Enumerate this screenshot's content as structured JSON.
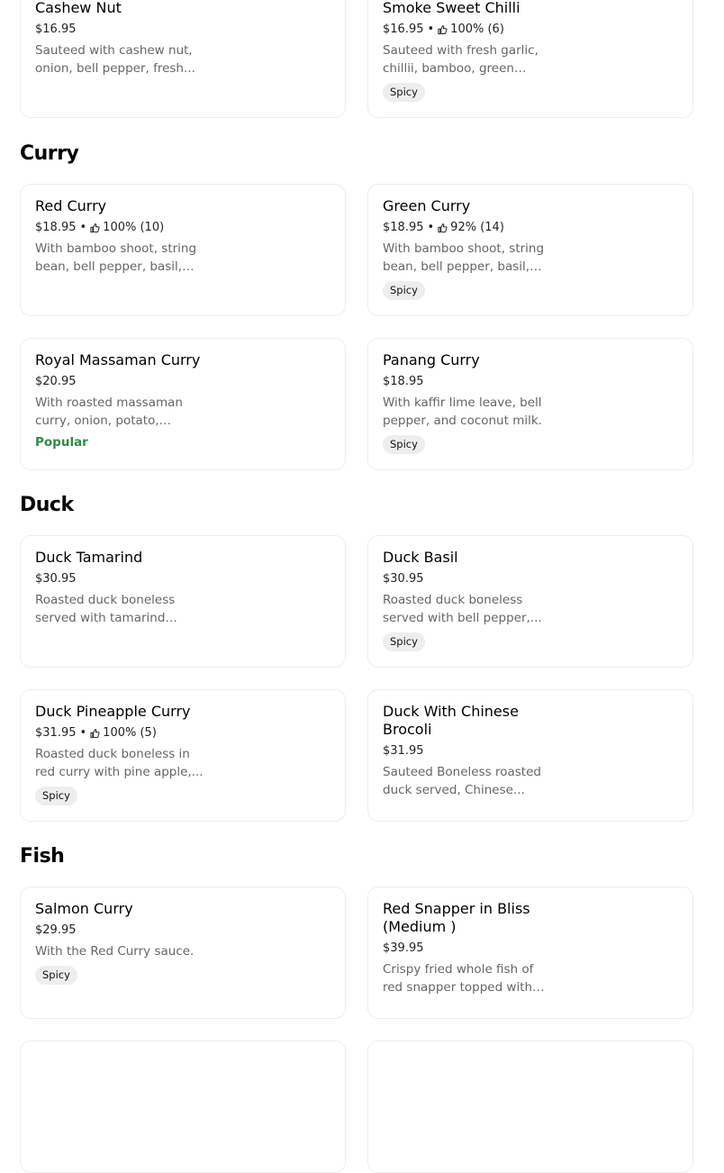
{
  "sections": [
    {
      "title": null,
      "items": [
        {
          "name": "Cashew Nut",
          "price": "$16.95",
          "description": "Sauteed with cashew nut, onion, bell pepper, fresh..."
        },
        {
          "name": "Smoke Sweet Chilli",
          "price": "$16.95",
          "sep": "•",
          "rating": "100% (6)",
          "description": "Sauteed with fresh garlic, chillii, bamboo, green bean...",
          "badge": "Spicy"
        }
      ]
    },
    {
      "title": "Curry",
      "items": [
        {
          "name": "Red Curry",
          "price": "$18.95",
          "sep": "•",
          "rating": "100% (10)",
          "description": "With bamboo shoot, string bean, bell pepper, basil, an..."
        },
        {
          "name": "Green Curry",
          "price": "$18.95",
          "sep": "•",
          "rating": "92% (14)",
          "description": "With bamboo shoot, string bean, bell pepper, basil, an...",
          "badge": "Spicy"
        },
        {
          "name": "Royal Massaman Curry",
          "price": "$20.95",
          "description": "With roasted massaman curry, onion, potato, tomat...",
          "popular": "Popular"
        },
        {
          "name": "Panang Curry",
          "price": "$18.95",
          "description": "With kaffir lime leave, bell pepper, and coconut milk.",
          "badge": "Spicy"
        }
      ]
    },
    {
      "title": "Duck",
      "items": [
        {
          "name": "Duck Tamarind",
          "price": "$30.95",
          "description": "Roasted duck boneless served with tamarind sauc..."
        },
        {
          "name": "Duck Basil",
          "price": "$30.95",
          "description": "Roasted duck boneless served with bell pepper,...",
          "badge": "Spicy"
        },
        {
          "name": "Duck Pineapple Curry",
          "price": "$31.95",
          "sep": "•",
          "rating": "100% (5)",
          "description": "Roasted duck boneless in red curry with pine apple,...",
          "badge": "Spicy"
        },
        {
          "name": "Duck With Chinese Brocoli",
          "price": "$31.95",
          "description": "Sauteed Boneless roasted duck served, Chinese..."
        }
      ]
    },
    {
      "title": "Fish",
      "items": [
        {
          "name": "Salmon Curry",
          "price": "$29.95",
          "description": "With the Red Curry sauce.",
          "badge": "Spicy"
        },
        {
          "name": "Red Snapper in Bliss (Medium )",
          "price": "$39.95",
          "description": "Crispy fried whole fish of red snapper topped with a..."
        }
      ]
    }
  ],
  "colors": {
    "popular": "#2f8a48",
    "badge_bg": "#eeeeee",
    "card_border": "#eeeeee",
    "desc": "#666666"
  },
  "icons": {
    "rating": "thumbs-up-icon"
  }
}
